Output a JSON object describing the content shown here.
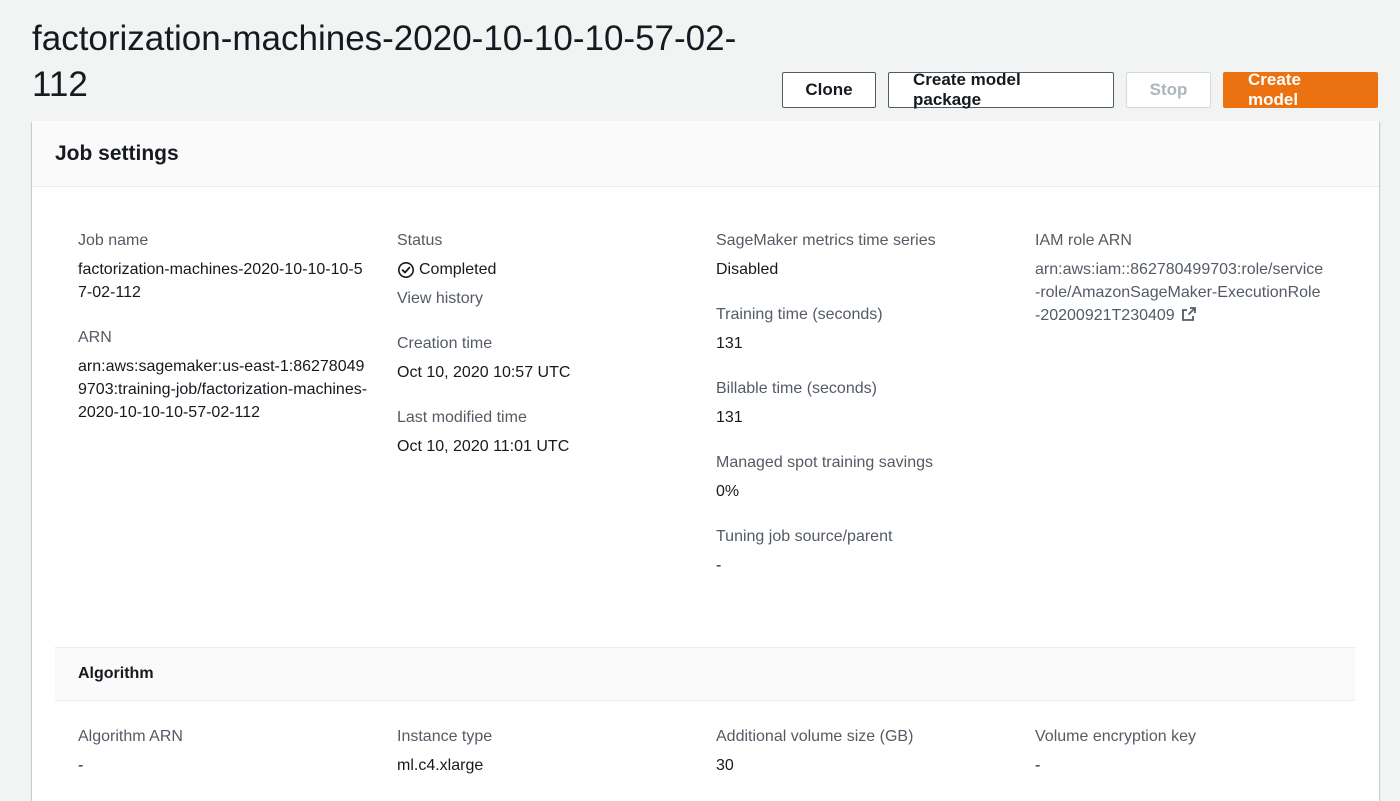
{
  "page": {
    "title": "factorization-machines-2020-10-10-10-57-02-112"
  },
  "actions": {
    "clone": "Clone",
    "create_model_package": "Create model package",
    "stop": "Stop",
    "create_model": "Create model"
  },
  "colors": {
    "primary": "#ec7211",
    "background": "#f2f3f3",
    "panel": "#ffffff"
  },
  "job_settings": {
    "heading": "Job settings",
    "job_name_label": "Job name",
    "job_name": "factorization-machines-2020-10-10-10-57-02-112",
    "arn_label": "ARN",
    "arn": "arn:aws:sagemaker:us-east-1:862780499703:training-job/factorization-machines-2020-10-10-10-57-02-112",
    "status_label": "Status",
    "status": "Completed",
    "status_icon": "check-circle-icon",
    "view_history": "View history",
    "creation_time_label": "Creation time",
    "creation_time": "Oct 10, 2020 10:57 UTC",
    "last_modified_label": "Last modified time",
    "last_modified": "Oct 10, 2020 11:01 UTC",
    "metrics_label": "SageMaker metrics time series",
    "metrics": "Disabled",
    "training_time_label": "Training time (seconds)",
    "training_time": "131",
    "billable_time_label": "Billable time (seconds)",
    "billable_time": "131",
    "spot_savings_label": "Managed spot training savings",
    "spot_savings": "0%",
    "tuning_label": "Tuning job source/parent",
    "tuning": "-",
    "iam_label": "IAM role ARN",
    "iam": "arn:aws:iam::862780499703:role/service-role/AmazonSageMaker-ExecutionRole-20200921T230409",
    "iam_icon": "external-link-icon"
  },
  "algorithm": {
    "heading": "Algorithm",
    "algorithm_arn_label": "Algorithm ARN",
    "algorithm_arn": "-",
    "instance_type_label": "Instance type",
    "instance_type": "ml.c4.xlarge",
    "volume_size_label": "Additional volume size (GB)",
    "volume_size": "30",
    "encryption_key_label": "Volume encryption key",
    "encryption_key": "-"
  }
}
